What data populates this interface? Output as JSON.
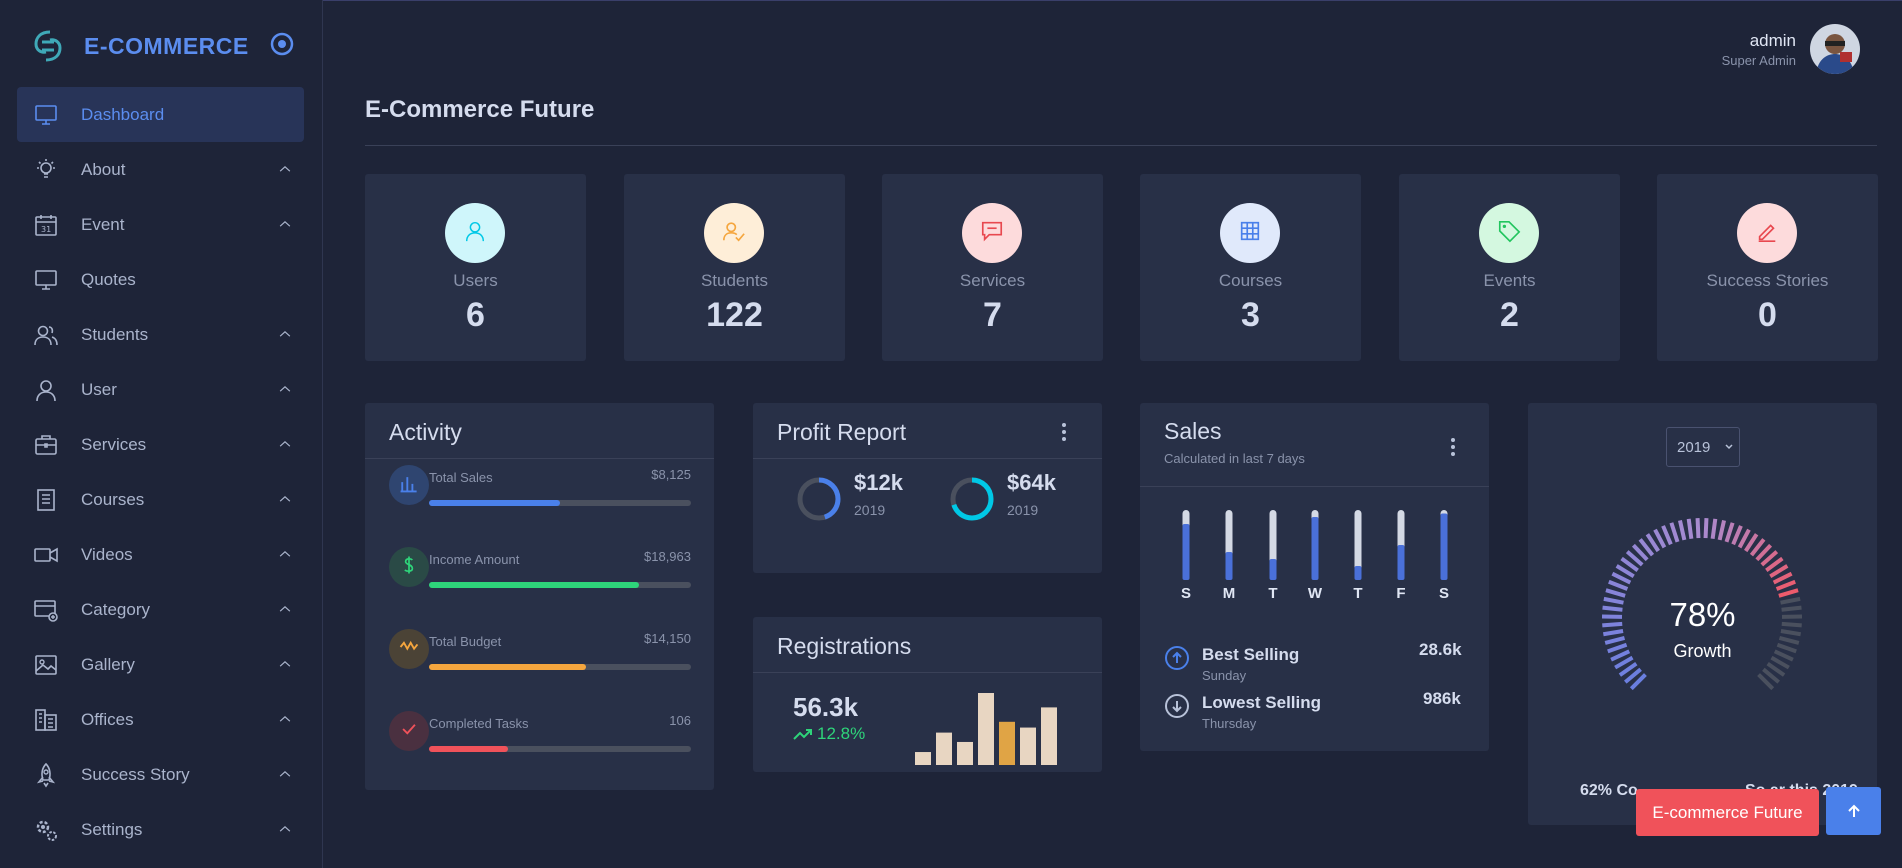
{
  "brand": {
    "name": "E-COMMERCE"
  },
  "sidebar": {
    "items": [
      {
        "label": "Dashboard",
        "icon": "monitor-icon",
        "active": true
      },
      {
        "label": "About",
        "icon": "lightbulb-icon"
      },
      {
        "label": "Event",
        "icon": "calendar-icon"
      },
      {
        "label": "Quotes",
        "icon": "monitor-icon"
      },
      {
        "label": "Students",
        "icon": "users-icon"
      },
      {
        "label": "User",
        "icon": "user-icon"
      },
      {
        "label": "Services",
        "icon": "briefcase-icon"
      },
      {
        "label": "Courses",
        "icon": "document-icon"
      },
      {
        "label": "Videos",
        "icon": "video-icon"
      },
      {
        "label": "Category",
        "icon": "category-icon"
      },
      {
        "label": "Gallery",
        "icon": "image-icon"
      },
      {
        "label": "Offices",
        "icon": "building-icon"
      },
      {
        "label": "Success Story",
        "icon": "rocket-icon"
      },
      {
        "label": "Settings",
        "icon": "gears-icon"
      }
    ]
  },
  "header": {
    "user_name": "admin",
    "user_role": "Super Admin"
  },
  "page": {
    "title": "E-Commerce Future"
  },
  "stats": [
    {
      "label": "Users",
      "value": "6",
      "icon": "user-icon",
      "color": "#00c8e6",
      "bg": "#cff6fb"
    },
    {
      "label": "Students",
      "value": "122",
      "icon": "user-check-icon",
      "color": "#f5a63e",
      "bg": "#feeed8"
    },
    {
      "label": "Services",
      "value": "7",
      "icon": "message-icon",
      "color": "#e8484f",
      "bg": "#fddbdc"
    },
    {
      "label": "Courses",
      "value": "3",
      "icon": "grid-icon",
      "color": "#4a80ea",
      "bg": "#e0e9fb"
    },
    {
      "label": "Events",
      "value": "2",
      "icon": "tag-icon",
      "color": "#22c55e",
      "bg": "#d4f8e0"
    },
    {
      "label": "Success Stories",
      "value": "0",
      "icon": "edit-icon",
      "color": "#e8484f",
      "bg": "#fddbdc"
    }
  ],
  "activity": {
    "title": "Activity",
    "rows": [
      {
        "label": "Total Sales",
        "value": "$8,125",
        "progress": 0.5,
        "color": "#4a80ea",
        "icon_bg": "#2f4570"
      },
      {
        "label": "Income Amount",
        "value": "$18,963",
        "progress": 0.8,
        "color": "#2ed47a",
        "icon_bg": "#2a4a46"
      },
      {
        "label": "Total Budget",
        "value": "$14,150",
        "progress": 0.6,
        "color": "#f5a63e",
        "icon_bg": "#4b4336"
      },
      {
        "label": "Completed Tasks",
        "value": "106",
        "progress": 0.3,
        "color": "#f0525a",
        "icon_bg": "#4a3040"
      }
    ]
  },
  "profit_report": {
    "title": "Profit Report",
    "items": [
      {
        "value": "$12k",
        "year": "2019",
        "progress": 0.45,
        "color": "#4a80ea"
      },
      {
        "value": "$64k",
        "year": "2019",
        "progress": 0.7,
        "color": "#00c8e6"
      }
    ]
  },
  "registrations": {
    "title": "Registrations",
    "value": "56.3k",
    "change": "12.8%",
    "bars": [
      0.18,
      0.45,
      0.32,
      1.0,
      0.6,
      0.52,
      0.8
    ],
    "highlight_index": 4
  },
  "sales": {
    "title": "Sales",
    "subtitle": "Calculated in last 7 days",
    "days": [
      "S",
      "M",
      "T",
      "W",
      "T",
      "F",
      "S"
    ],
    "levels": [
      0.8,
      0.4,
      0.3,
      0.9,
      0.2,
      0.5,
      0.95
    ],
    "best": {
      "label": "Best Selling",
      "day": "Sunday",
      "value": "28.6k"
    },
    "lowest": {
      "label": "Lowest Selling",
      "day": "Thursday",
      "value": "986k"
    }
  },
  "growth": {
    "year": "2019",
    "percent": "78%",
    "label": "Growth",
    "footer": "62% Co",
    "footer_tail": "So ar this 2019"
  },
  "buttons": {
    "future_label": "E-commerce Future"
  }
}
